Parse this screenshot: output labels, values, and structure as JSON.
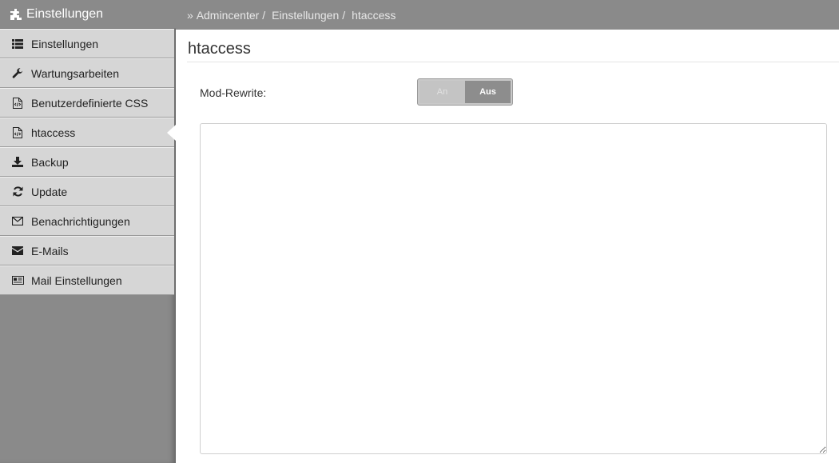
{
  "sidebar": {
    "title": "Einstellungen",
    "title_icon": "puzzle-icon",
    "items": [
      {
        "label": "Einstellungen",
        "icon": "list-icon"
      },
      {
        "label": "Wartungsarbeiten",
        "icon": "wrench-icon"
      },
      {
        "label": "Benutzerdefinierte CSS",
        "icon": "code-file-icon"
      },
      {
        "label": "htaccess",
        "icon": "code-file-icon",
        "active": true
      },
      {
        "label": "Backup",
        "icon": "download-icon"
      },
      {
        "label": "Update",
        "icon": "refresh-icon"
      },
      {
        "label": "Benachrichtigungen",
        "icon": "envelope-outline-icon"
      },
      {
        "label": "E-Mails",
        "icon": "envelope-icon"
      },
      {
        "label": "Mail Einstellungen",
        "icon": "newspaper-icon"
      }
    ]
  },
  "breadcrumb": {
    "prefix": "»",
    "items": [
      "Admincenter",
      "Einstellungen",
      "htaccess"
    ],
    "separator": "/"
  },
  "page": {
    "title": "htaccess",
    "mod_rewrite": {
      "label": "Mod-Rewrite:",
      "on_label": "An",
      "off_label": "Aus",
      "selected": "Aus"
    },
    "editor_value": ""
  },
  "colors": {
    "sidebar_bg": "#8a8a8a",
    "menu_item_bg": "#d6d6d6",
    "topbar_bg": "#8a8a8a"
  }
}
